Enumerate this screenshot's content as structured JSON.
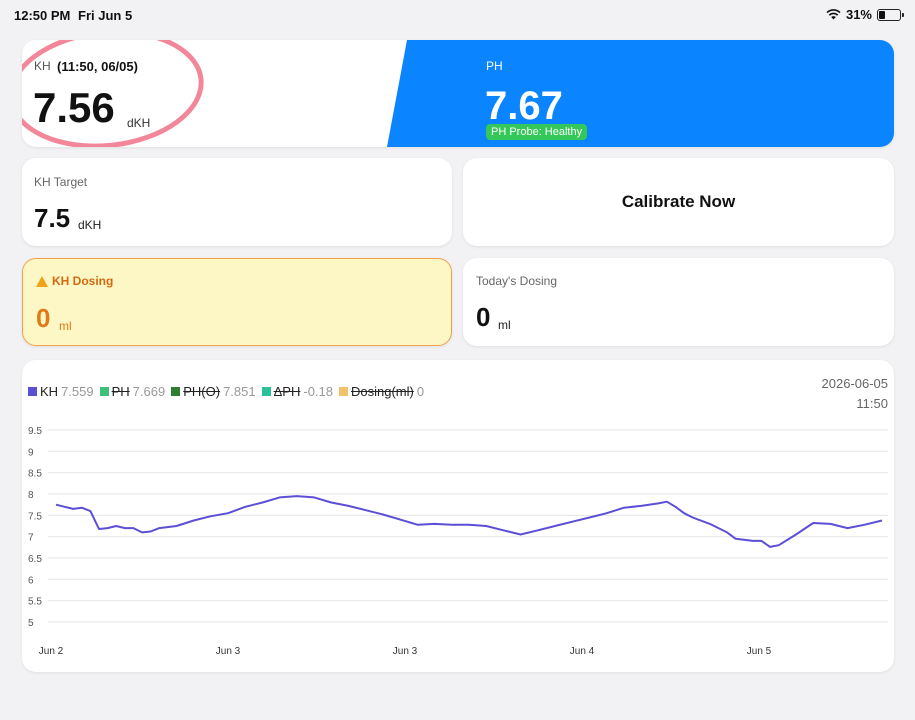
{
  "status_bar": {
    "time": "12:50 PM",
    "date": "Fri Jun 5",
    "battery": "31%",
    "battery_level": 0.31
  },
  "kh_card": {
    "label": "KH",
    "time": "(11:50, 06/05)",
    "value": "7.56",
    "unit": "dKH"
  },
  "ph_card": {
    "label": "PH",
    "value": "7.67",
    "badge": "PH Probe: Healthy"
  },
  "kh_target": {
    "label": "KH Target",
    "value": "7.5",
    "unit": "dKH"
  },
  "calibrate": {
    "label": "Calibrate Now"
  },
  "kh_dosing": {
    "label": "KH Dosing",
    "value": "0",
    "unit": "ml"
  },
  "today_dosing": {
    "label": "Today's Dosing",
    "value": "0",
    "unit": "ml"
  },
  "colors": {
    "kh": "#5b4fd6",
    "ph": "#3cc07b",
    "ph_o": "#2e7d32",
    "delta_ph": "#2bbf9a",
    "dosing": "#f4c16b",
    "accent_blue": "#0a84ff",
    "warning": "#e07a16"
  },
  "chart_data": {
    "type": "line",
    "legend": [
      {
        "name": "KH",
        "value": "7.559",
        "active": true
      },
      {
        "name": "PH",
        "value": "7.669",
        "active": false
      },
      {
        "name": "PH(O)",
        "value": "7.851",
        "active": false
      },
      {
        "name": "ΔPH",
        "value": "-0.18",
        "active": false
      },
      {
        "name": "Dosing(ml)",
        "value": "0",
        "active": false
      }
    ],
    "timestamp_date": "2026-06-05",
    "timestamp_time": "11:50",
    "y_ticks": [
      "9.5",
      "9",
      "8.5",
      "8",
      "7.5",
      "7",
      "6.5",
      "6",
      "5.5",
      "5"
    ],
    "ylim": [
      5,
      9.5
    ],
    "x_ticks": [
      "Jun 2",
      "Jun 3",
      "Jun 3",
      "Jun 4",
      "Jun 5"
    ],
    "xlim": [
      0,
      4.8
    ],
    "series": [
      {
        "name": "KH",
        "points": [
          [
            0.0,
            7.75
          ],
          [
            0.05,
            7.7
          ],
          [
            0.1,
            7.65
          ],
          [
            0.15,
            7.68
          ],
          [
            0.2,
            7.6
          ],
          [
            0.25,
            7.18
          ],
          [
            0.3,
            7.2
          ],
          [
            0.35,
            7.25
          ],
          [
            0.4,
            7.2
          ],
          [
            0.45,
            7.2
          ],
          [
            0.5,
            7.1
          ],
          [
            0.55,
            7.12
          ],
          [
            0.6,
            7.2
          ],
          [
            0.7,
            7.25
          ],
          [
            0.8,
            7.38
          ],
          [
            0.9,
            7.48
          ],
          [
            1.0,
            7.55
          ],
          [
            1.1,
            7.7
          ],
          [
            1.2,
            7.8
          ],
          [
            1.3,
            7.92
          ],
          [
            1.4,
            7.95
          ],
          [
            1.5,
            7.92
          ],
          [
            1.6,
            7.8
          ],
          [
            1.7,
            7.72
          ],
          [
            1.8,
            7.62
          ],
          [
            1.9,
            7.52
          ],
          [
            2.0,
            7.4
          ],
          [
            2.1,
            7.28
          ],
          [
            2.2,
            7.3
          ],
          [
            2.3,
            7.28
          ],
          [
            2.4,
            7.28
          ],
          [
            2.5,
            7.25
          ],
          [
            2.6,
            7.15
          ],
          [
            2.7,
            7.05
          ],
          [
            2.8,
            7.15
          ],
          [
            2.9,
            7.25
          ],
          [
            3.0,
            7.35
          ],
          [
            3.1,
            7.45
          ],
          [
            3.2,
            7.55
          ],
          [
            3.3,
            7.68
          ],
          [
            3.4,
            7.72
          ],
          [
            3.5,
            7.78
          ],
          [
            3.55,
            7.82
          ],
          [
            3.6,
            7.7
          ],
          [
            3.65,
            7.55
          ],
          [
            3.7,
            7.45
          ],
          [
            3.8,
            7.3
          ],
          [
            3.9,
            7.1
          ],
          [
            3.95,
            6.95
          ],
          [
            4.05,
            6.9
          ],
          [
            4.1,
            6.9
          ],
          [
            4.15,
            6.76
          ],
          [
            4.2,
            6.8
          ],
          [
            4.3,
            7.05
          ],
          [
            4.4,
            7.32
          ],
          [
            4.5,
            7.3
          ],
          [
            4.6,
            7.2
          ],
          [
            4.7,
            7.28
          ],
          [
            4.8,
            7.38
          ]
        ]
      }
    ]
  }
}
